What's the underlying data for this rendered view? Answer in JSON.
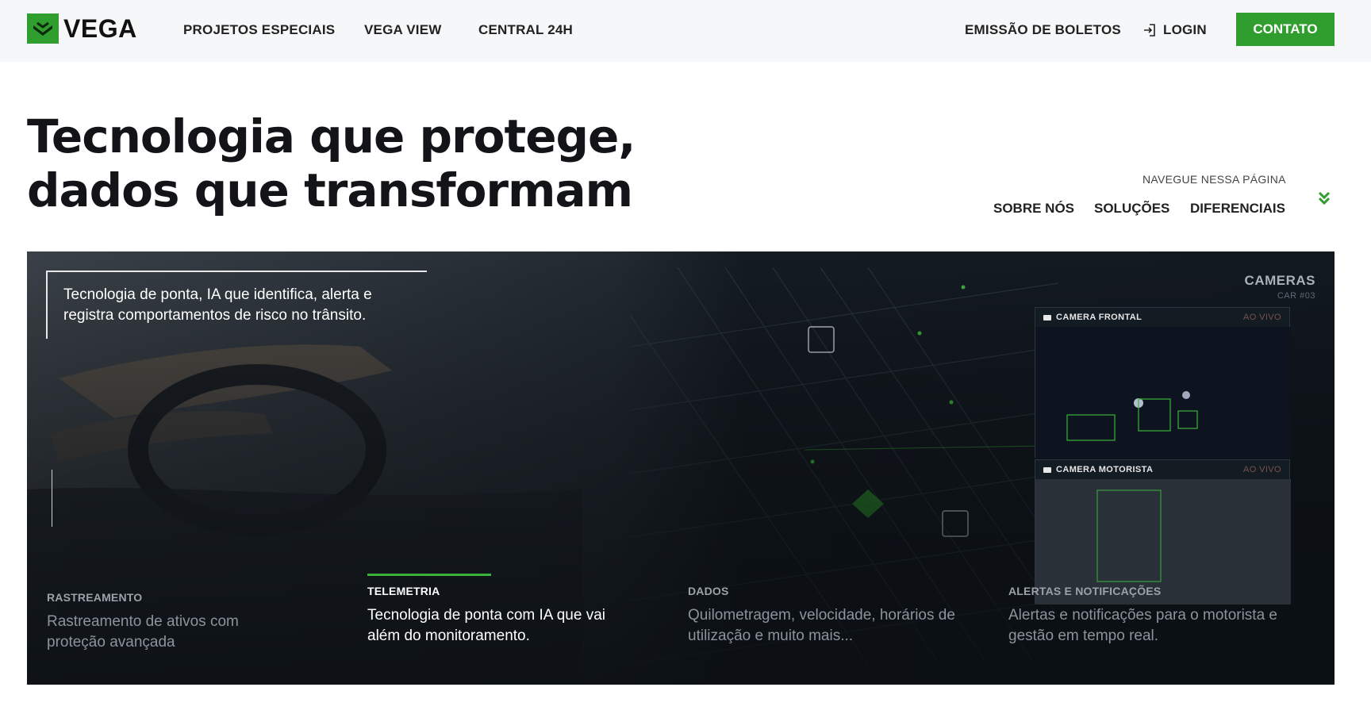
{
  "header": {
    "logo_text": "VEGA",
    "nav": [
      "PROJETOS ESPECIAIS",
      "VEGA VIEW",
      "CENTRAL 24H"
    ],
    "boletos": "EMISSÃO DE BOLETOS",
    "login": "LOGIN",
    "contact": "CONTATO",
    "brand_color": "#2f9e2f"
  },
  "hero": {
    "title_line1": "Tecnologia que protege,",
    "title_line2": "dados que transformam"
  },
  "page_nav": {
    "label": "NAVEGUE NESSA PÁGINA",
    "items": [
      "SOBRE NÓS",
      "SOLUÇÕES",
      "DIFERENCIAIS"
    ]
  },
  "panel": {
    "callout": "Tecnologia de ponta, IA que identifica, alerta e registra comportamentos de risco no trânsito.",
    "cameras": {
      "title": "CAMERAS",
      "sub": "CAR #03",
      "frontal": "CAMERA FRONTAL",
      "motorista": "CAMERA MOTORISTA",
      "live": "AO VIVO"
    },
    "tabs": [
      {
        "label": "RASTREAMENTO",
        "desc": "Rastreamento de ativos com proteção avançada",
        "active": false
      },
      {
        "label": "TELEMETRIA",
        "desc": "Tecnologia de ponta com IA que vai além do monitoramento.",
        "active": true
      },
      {
        "label": "DADOS",
        "desc": "Quilometragem, velocidade, horários de utilização e muito mais...",
        "active": false
      },
      {
        "label": "ALERTAS E NOTIFICAÇÕES",
        "desc": "Alertas e notificações para o motorista e gestão em tempo real.",
        "active": false
      }
    ]
  }
}
